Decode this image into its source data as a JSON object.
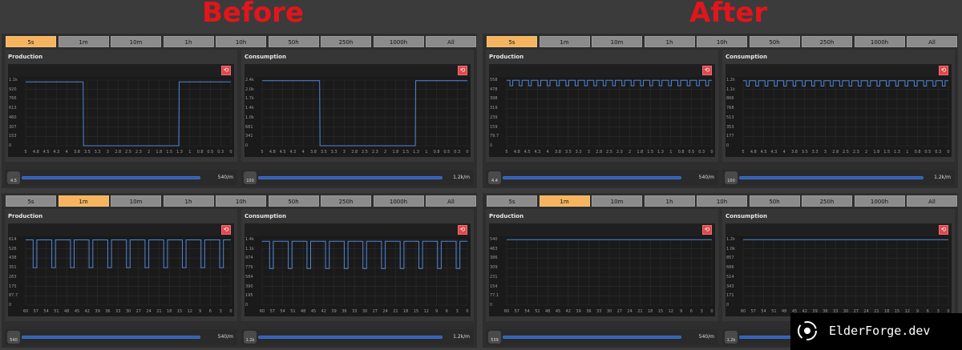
{
  "labels": {
    "before": "Before",
    "after": "After"
  },
  "watermark": "ElderForge.dev",
  "colors": {
    "line": "#4f86d9",
    "title": "#e3151b",
    "activeTab": "#f6b45e"
  },
  "tabs": [
    "5s",
    "1m",
    "10m",
    "1h",
    "10h",
    "50h",
    "250h",
    "1000h",
    "All"
  ],
  "panels": [
    {
      "id": "before-5s",
      "active_tab": 0,
      "charts": [
        {
          "title": "Production",
          "yticks": [
            "1.1k",
            "920",
            "766",
            "613",
            "460",
            "307",
            "153",
            "0"
          ],
          "xticks": [
            "5",
            "4.8",
            "4.5",
            "4.3",
            "4",
            "3.8",
            "3.5",
            "3.3",
            "3",
            "2.8",
            "2.5",
            "2.3",
            "2",
            "1.8",
            "1.5",
            "1.3",
            "1",
            "0.8",
            "0.5",
            "0.3",
            "0"
          ],
          "chart_data": {
            "type": "line",
            "x": [
              5,
              3.6,
              3.59,
              1.27,
              1.26,
              0
            ],
            "y": [
              1070,
              1070,
              0,
              0,
              1070,
              1070
            ],
            "xlim": [
              5,
              0
            ],
            "ylim": [
              0,
              1100
            ]
          }
        },
        {
          "title": "Consumption",
          "yticks": [
            "2.4k",
            "2.0k",
            "1.7k",
            "1.4k",
            "1.0k",
            "681",
            "341",
            "0"
          ],
          "xticks": [
            "5",
            "4.8",
            "4.5",
            "4.3",
            "4",
            "3.8",
            "3.5",
            "3.3",
            "3",
            "2.8",
            "2.5",
            "2.3",
            "2",
            "1.8",
            "1.5",
            "1.3",
            "1",
            "0.8",
            "0.5",
            "0.3",
            "0"
          ],
          "chart_data": {
            "type": "line",
            "x": [
              5,
              3.6,
              3.59,
              1.27,
              1.26,
              0
            ],
            "y": [
              2380,
              2380,
              0,
              0,
              2380,
              2380
            ],
            "xlim": [
              5,
              0
            ],
            "ylim": [
              0,
              2400
            ]
          }
        }
      ],
      "rates": [
        {
          "icon": "4.5",
          "value": "540/m",
          "fill": 0.95
        },
        {
          "icon": "100",
          "value": "1.2k/m",
          "fill": 0.98
        }
      ]
    },
    {
      "id": "after-5s",
      "active_tab": 0,
      "charts": [
        {
          "title": "Production",
          "yticks": [
            "558",
            "478",
            "398",
            "319",
            "239",
            "159",
            "79.7",
            "0"
          ],
          "xticks": [
            "5",
            "4.8",
            "4.5",
            "4.3",
            "4",
            "3.8",
            "3.5",
            "3.3",
            "3",
            "2.8",
            "2.5",
            "2.3",
            "2",
            "1.8",
            "1.5",
            "1.3",
            "1",
            "0.8",
            "0.5",
            "0.3",
            "0"
          ],
          "chart_data": {
            "type": "line",
            "pattern": "square",
            "periods": 22,
            "high": 556,
            "low": 510,
            "xlim": [
              5,
              0
            ],
            "ylim": [
              0,
              558
            ]
          }
        },
        {
          "title": "Consumption",
          "yticks": [
            "1.2k",
            "1.1k",
            "866",
            "768",
            "513",
            "353",
            "177",
            "0"
          ],
          "xticks": [
            "5",
            "4.8",
            "4.5",
            "4.3",
            "4",
            "3.8",
            "3.5",
            "3.3",
            "3",
            "2.8",
            "2.5",
            "2.3",
            "2",
            "1.8",
            "1.5",
            "1.3",
            "1",
            "0.8",
            "0.5",
            "0.3",
            "0"
          ],
          "chart_data": {
            "type": "line",
            "pattern": "square",
            "periods": 22,
            "high": 1190,
            "low": 1090,
            "xlim": [
              5,
              0
            ],
            "ylim": [
              0,
              1200
            ]
          }
        }
      ],
      "rates": [
        {
          "icon": "4.4",
          "value": "540/m",
          "fill": 0.95
        },
        {
          "icon": "100",
          "value": "1.2k/m",
          "fill": 0.98
        }
      ]
    },
    {
      "id": "before-1m",
      "active_tab": 1,
      "charts": [
        {
          "title": "Production",
          "yticks": [
            "614",
            "526",
            "438",
            "351",
            "263",
            "175",
            "87.7",
            "0"
          ],
          "xticks": [
            "60",
            "57",
            "54",
            "51",
            "48",
            "45",
            "42",
            "39",
            "36",
            "33",
            "30",
            "27",
            "24",
            "21",
            "18",
            "15",
            "12",
            "9",
            "6",
            "3",
            "0"
          ],
          "chart_data": {
            "type": "line",
            "pattern": "pulse",
            "periods": 11,
            "high": 610,
            "low": 350,
            "xlim": [
              60,
              0
            ],
            "ylim": [
              0,
              614
            ]
          }
        },
        {
          "title": "Consumption",
          "yticks": [
            "1.4k",
            "1.1k",
            "974",
            "779",
            "584",
            "390",
            "195",
            "0"
          ],
          "xticks": [
            "60",
            "57",
            "54",
            "51",
            "48",
            "45",
            "42",
            "39",
            "36",
            "33",
            "30",
            "27",
            "24",
            "21",
            "18",
            "15",
            "12",
            "9",
            "6",
            "3",
            "0"
          ],
          "chart_data": {
            "type": "line",
            "pattern": "pulse",
            "periods": 11,
            "high": 1360,
            "low": 780,
            "xlim": [
              60,
              0
            ],
            "ylim": [
              0,
              1400
            ]
          }
        }
      ],
      "rates": [
        {
          "icon": "540",
          "value": "540/m",
          "fill": 0.95
        },
        {
          "icon": "1.2k",
          "value": "1.2k/m",
          "fill": 0.98
        }
      ]
    },
    {
      "id": "after-1m",
      "active_tab": 1,
      "charts": [
        {
          "title": "Production",
          "yticks": [
            "540",
            "463",
            "386",
            "309",
            "231",
            "154",
            "77.1",
            "0"
          ],
          "xticks": [
            "60",
            "57",
            "54",
            "51",
            "48",
            "45",
            "42",
            "39",
            "36",
            "33",
            "30",
            "27",
            "24",
            "21",
            "18",
            "15",
            "12",
            "9",
            "6",
            "3",
            "0"
          ],
          "chart_data": {
            "type": "line",
            "x": [
              60,
              0
            ],
            "y": [
              538,
              538
            ],
            "xlim": [
              60,
              0
            ],
            "ylim": [
              0,
              540
            ]
          }
        },
        {
          "title": "Consumption",
          "yticks": [
            "1.2k",
            "1.0k",
            "857",
            "686",
            "514",
            "343",
            "171",
            "0"
          ],
          "xticks": [
            "60",
            "57",
            "54",
            "51",
            "48",
            "45",
            "42",
            "39",
            "36",
            "33",
            "30",
            "27",
            "24",
            "21",
            "18",
            "15",
            "12",
            "9",
            "6",
            "3",
            "0"
          ],
          "chart_data": {
            "type": "line",
            "x": [
              60,
              0
            ],
            "y": [
              1195,
              1195
            ],
            "xlim": [
              60,
              0
            ],
            "ylim": [
              0,
              1200
            ]
          }
        }
      ],
      "rates": [
        {
          "icon": "539",
          "value": "540/m",
          "fill": 0.95
        },
        {
          "icon": "1.2k",
          "value": "1.2k/m",
          "fill": 0.98
        }
      ]
    }
  ]
}
